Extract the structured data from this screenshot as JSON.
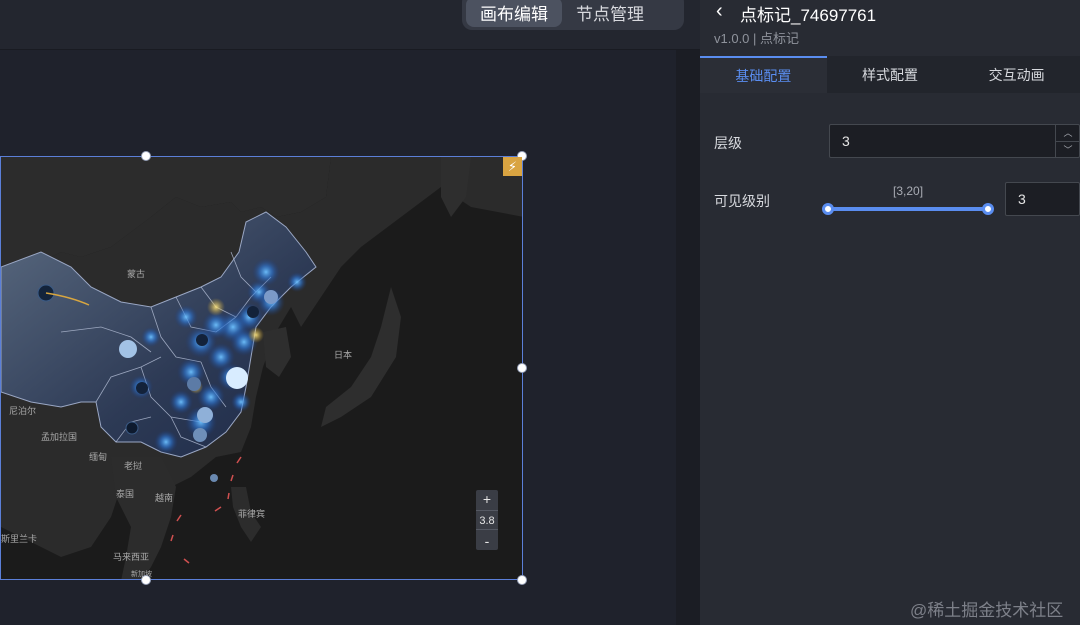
{
  "toolbar": {
    "tabs": [
      {
        "label": "画布编辑",
        "active": true
      },
      {
        "label": "节点管理",
        "active": false
      }
    ]
  },
  "map": {
    "zoom_in_label": "+",
    "zoom_level": "3.8",
    "zoom_out_label": "-",
    "labels": [
      "蒙古",
      "日本",
      "尼泊尔",
      "孟加拉国",
      "缅甸",
      "老挝",
      "泰国",
      "越南",
      "菲律宾",
      "斯里兰卡",
      "马来西亚",
      "新加坡"
    ]
  },
  "panel": {
    "title": "点标记_74697761",
    "subtitle": "v1.0.0 | 点标记",
    "tabs": [
      {
        "label": "基础配置",
        "active": true
      },
      {
        "label": "样式配置",
        "active": false
      },
      {
        "label": "交互动画",
        "active": false
      }
    ],
    "level": {
      "label": "层级",
      "value": "3"
    },
    "visible_level": {
      "label": "可见级别",
      "range_label": "[3,20]",
      "value": "3",
      "min": 3,
      "max": 20
    }
  },
  "watermark": "@稀土掘金技术社区",
  "colors": {
    "accent": "#5a8df0",
    "map_border": "#5b7fd8",
    "bolt": "#d9a441"
  }
}
